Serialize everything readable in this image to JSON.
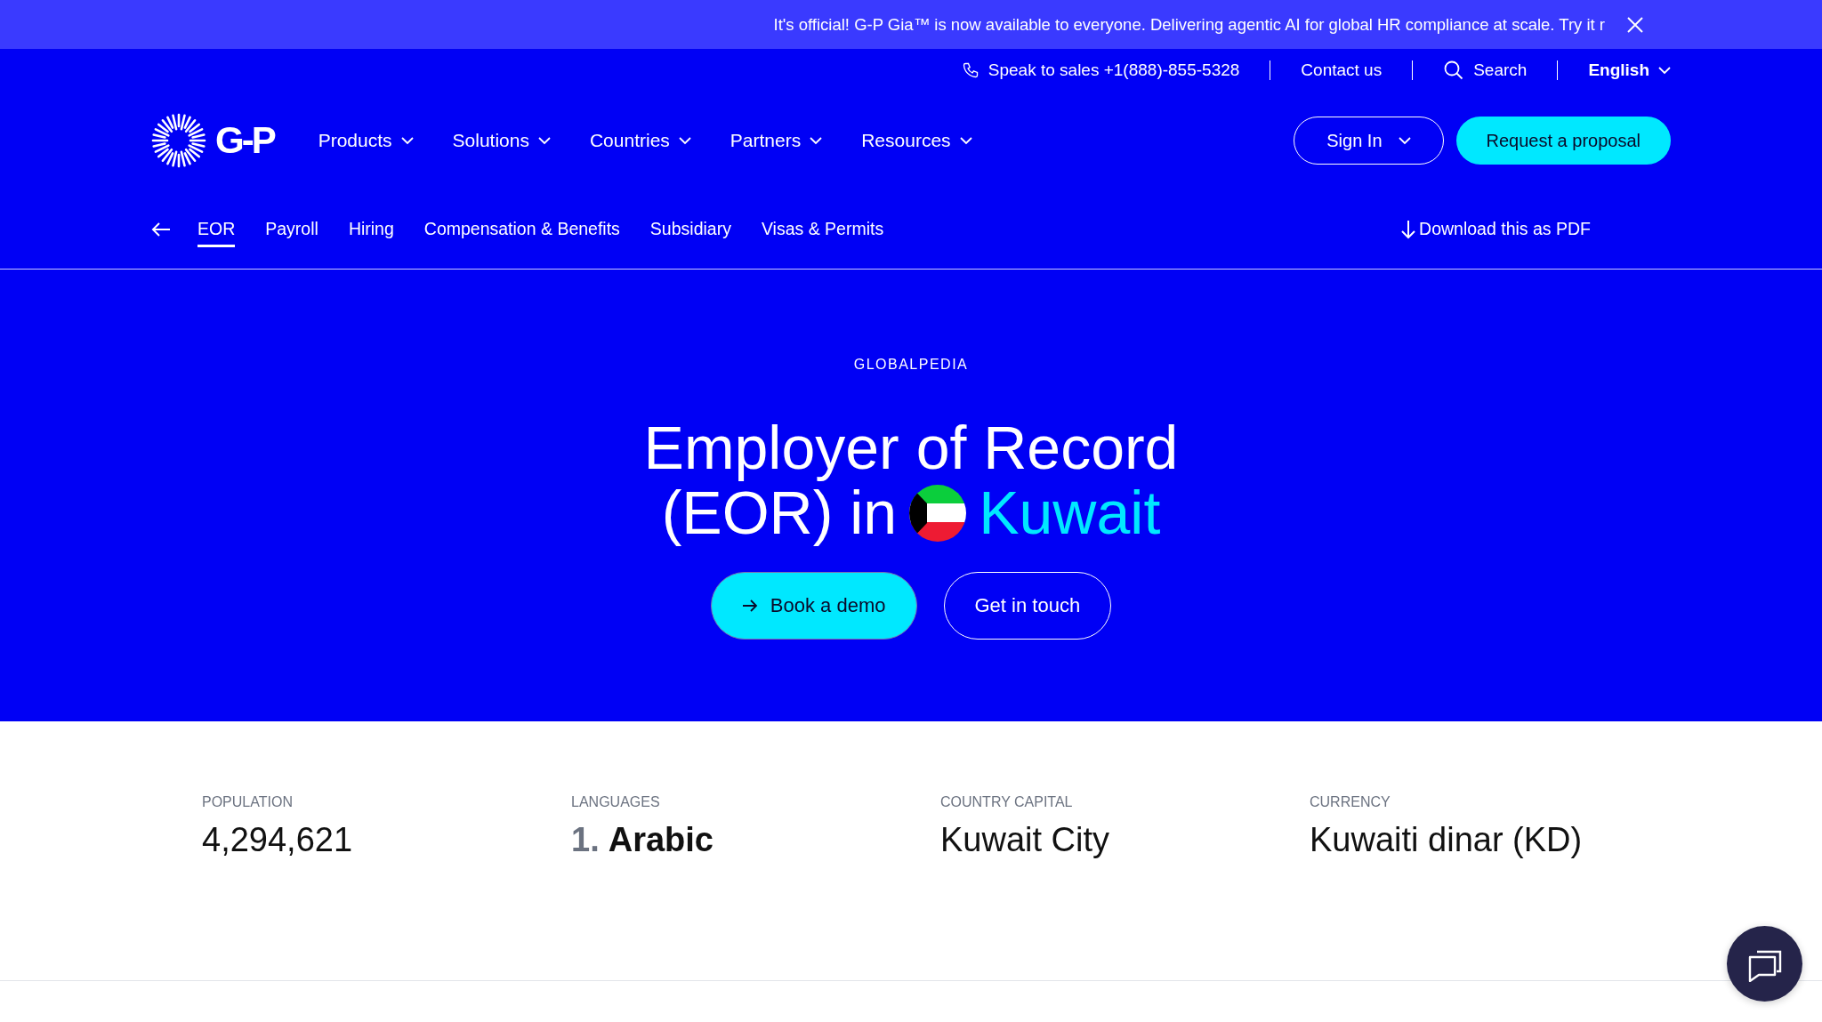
{
  "banner": {
    "text": "It's official! G-P Gia™ is now available to everyone. Delivering agentic AI for global HR compliance at scale. Try it r"
  },
  "utility_bar": {
    "phone": "Speak to sales +1(888)-855-5328",
    "contact": "Contact us",
    "search": "Search",
    "language": "English"
  },
  "nav": {
    "logo": "G-P",
    "items": [
      {
        "label": "Products"
      },
      {
        "label": "Solutions"
      },
      {
        "label": "Countries"
      },
      {
        "label": "Partners"
      },
      {
        "label": "Resources"
      }
    ],
    "sign_in": "Sign In",
    "cta": "Request a proposal"
  },
  "subnav": {
    "tabs": [
      {
        "label": "EOR",
        "selected": true
      },
      {
        "label": "Payroll",
        "selected": false
      },
      {
        "label": "Hiring",
        "selected": false
      },
      {
        "label": "Compensation & Benefits",
        "selected": false
      },
      {
        "label": "Subsidiary",
        "selected": false
      },
      {
        "label": "Visas & Permits",
        "selected": false
      }
    ],
    "download": "Download this as PDF"
  },
  "hero": {
    "eyebrow": "GLOBALPEDIA",
    "title_line": "Employer of Record",
    "title_prefix": "(EOR) in",
    "country": "Kuwait",
    "primary_button": "Book a demo",
    "secondary_button": "Get in touch"
  },
  "stats": [
    {
      "label": "POPULATION",
      "kind": "text",
      "value": "4,294,621"
    },
    {
      "label": "LANGUAGES",
      "kind": "list",
      "items": [
        {
          "number": "1.",
          "text": "Arabic"
        }
      ]
    },
    {
      "label": "COUNTRY CAPITAL",
      "kind": "text",
      "value": "Kuwait City"
    },
    {
      "label": "CURRENCY",
      "kind": "text",
      "value": "Kuwaiti dinar (KD)"
    }
  ]
}
